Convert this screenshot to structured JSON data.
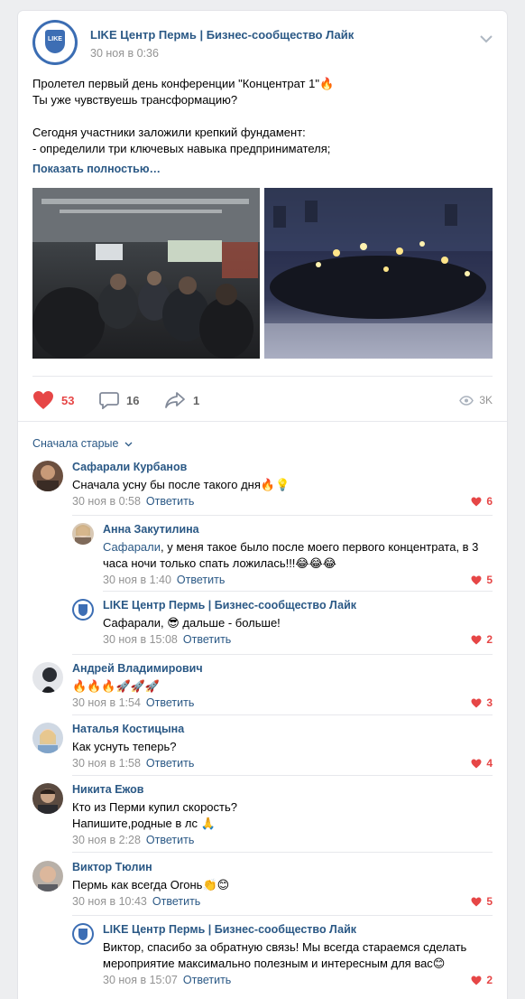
{
  "post": {
    "author": "LIKE Центр Пермь | Бизнес-сообщество Лайк",
    "date": "30 ноя в 0:36",
    "logo_text": "LIKE",
    "text_lines": [
      "Пролетел первый день конференции \"Концентрат 1\"🔥",
      "Ты уже чувствуешь трансформацию?",
      "",
      "Сегодня участники заложили крепкий фундамент:",
      "- определили три ключевых навыка предпринимателя;"
    ],
    "show_more": "Показать полностью…",
    "likes": "53",
    "comments": "16",
    "shares": "1",
    "views": "3K",
    "colors": {
      "like": "#e64646",
      "link": "#2a5885",
      "muted": "#939393"
    }
  },
  "sort_label": "Сначала старые",
  "comments": [
    {
      "name": "Сафарали Курбанов",
      "text": "Сначала усну бы после такого дня🔥💡",
      "date": "30 ноя в 0:58",
      "reply": "Ответить",
      "likes": "6"
    },
    {
      "name": "Анна Закутилина",
      "mention": "Сафарали",
      "text_line1": ", у меня такое было после моего первого концентрата, в 3",
      "text_line2": "часа ночи только спать ложилась!!!😂😂😂",
      "date": "30 ноя в 1:40",
      "reply": "Ответить",
      "likes": "5"
    },
    {
      "name": "LIKE Центр Пермь | Бизнес-сообщество Лайк",
      "mention": "Сафарали",
      "text": ", 😎 дальше - больше!",
      "date": "30 ноя в 15:08",
      "reply": "Ответить",
      "likes": "2"
    },
    {
      "name": "Андрей Владимирович",
      "text": "🔥🔥🔥🚀🚀🚀",
      "date": "30 ноя в 1:54",
      "reply": "Ответить",
      "likes": "3"
    },
    {
      "name": "Наталья Костицына",
      "text": "Как уснуть теперь?",
      "date": "30 ноя в 1:58",
      "reply": "Ответить",
      "likes": "4"
    },
    {
      "name": "Никита Ежов",
      "text_line1": "Кто из Перми купил скорость?",
      "text_line2": "Напишите,родные в лс 🙏",
      "date": "30 ноя в 2:28",
      "reply": "Ответить"
    },
    {
      "name": "Виктор Тюлин",
      "text": "Пермь как всегда Огонь👏😊",
      "date": "30 ноя в 10:43",
      "reply": "Ответить",
      "likes": "5"
    },
    {
      "name": "LIKE Центр Пермь | Бизнес-сообщество Лайк",
      "text_line1": "Виктор, спасибо за обратную связь! Мы всегда стараемся сделать",
      "text_line2": "мероприятие максимально полезным и интересным для вас😊",
      "date": "30 ноя в 15:07",
      "reply": "Ответить",
      "likes": "2"
    }
  ]
}
